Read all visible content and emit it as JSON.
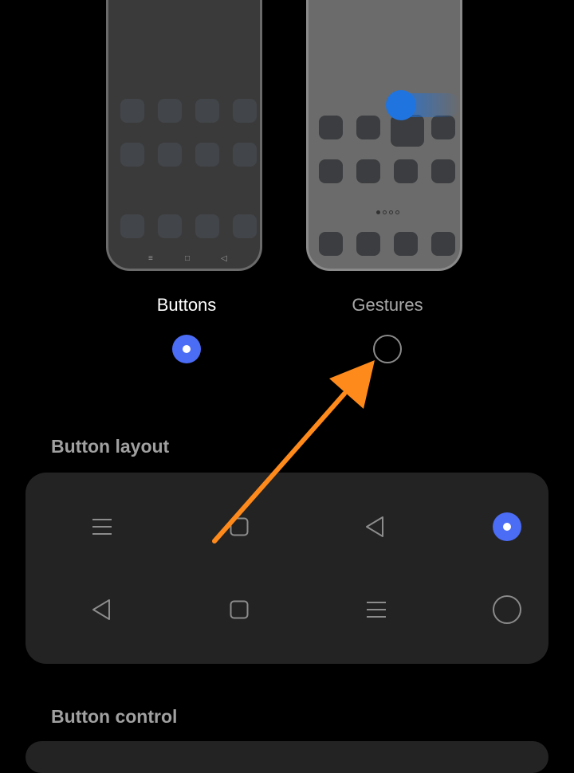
{
  "modes": [
    {
      "label": "Buttons",
      "selected": true
    },
    {
      "label": "Gestures",
      "selected": false
    }
  ],
  "button_layout": {
    "title": "Button layout",
    "options": [
      {
        "icons": [
          "menu-icon",
          "square-icon",
          "back-triangle-icon"
        ],
        "selected": true
      },
      {
        "icons": [
          "back-triangle-icon",
          "square-icon",
          "menu-icon"
        ],
        "selected": false
      }
    ]
  },
  "button_control": {
    "title": "Button control"
  },
  "colors": {
    "accent": "#4b6cf5",
    "arrow": "#ff8a1c",
    "card": "#232323"
  }
}
